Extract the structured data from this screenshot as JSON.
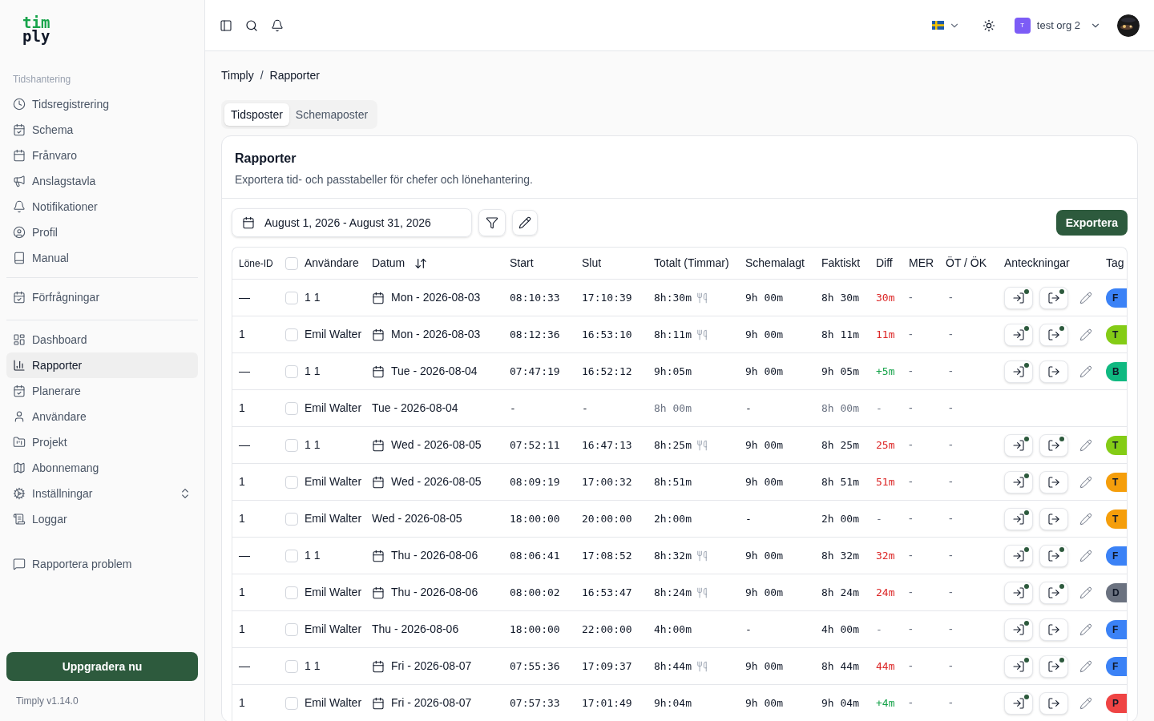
{
  "logo": {
    "top": "tim",
    "bottom": "ply"
  },
  "sidebar": {
    "groups": [
      {
        "label": "Tidshantering",
        "items": [
          {
            "label": "Tidsregistrering",
            "selected": false,
            "expandable": false
          },
          {
            "label": "Schema",
            "selected": false,
            "expandable": false
          },
          {
            "label": "Frånvaro",
            "selected": false,
            "expandable": false
          },
          {
            "label": "Anslagstavla",
            "selected": false,
            "expandable": false
          },
          {
            "label": "Notifikationer",
            "selected": false,
            "expandable": false
          },
          {
            "label": "Profil",
            "selected": false,
            "expandable": false
          },
          {
            "label": "Manual",
            "selected": false,
            "expandable": false
          }
        ]
      },
      {
        "items": [
          {
            "label": "Förfrågningar",
            "selected": false,
            "expandable": false
          }
        ]
      },
      {
        "items": [
          {
            "label": "Dashboard",
            "selected": false,
            "expandable": false
          },
          {
            "label": "Rapporter",
            "selected": true,
            "expandable": false
          },
          {
            "label": "Planerare",
            "selected": false,
            "expandable": false
          },
          {
            "label": "Användare",
            "selected": false,
            "expandable": false
          },
          {
            "label": "Projekt",
            "selected": false,
            "expandable": false
          },
          {
            "label": "Abonnemang",
            "selected": false,
            "expandable": false
          },
          {
            "label": "Inställningar",
            "selected": false,
            "expandable": true
          },
          {
            "label": "Loggar",
            "selected": false,
            "expandable": false
          }
        ]
      },
      {
        "items": [
          {
            "label": "Rapportera problem",
            "selected": false,
            "expandable": false
          }
        ]
      }
    ],
    "upgrade_button": "Uppgradera nu",
    "version": "Timply v1.14.0"
  },
  "header": {
    "org_badge": "T",
    "org_name": "test org 2"
  },
  "breadcrumb": {
    "items": [
      "Timply",
      "Rapporter"
    ],
    "separator": "/"
  },
  "tabs": [
    {
      "label": "Tidsposter",
      "selected": true
    },
    {
      "label": "Schemaposter",
      "selected": false
    }
  ],
  "card": {
    "title": "Rapporter",
    "subtitle": "Exportera tid- och passtabeller för chefer och lönehantering.",
    "date_range": "August 1, 2026 - August 31, 2026",
    "export_button": "Exportera"
  },
  "table": {
    "columns": [
      "Löne-ID",
      "Användare",
      "Datum",
      "Start",
      "Slut",
      "Totalt (Timmar)",
      "Schemalagt",
      "Faktiskt",
      "Diff",
      "MER",
      "ÖT / ÖK",
      "Anteckningar",
      "Tag"
    ],
    "select_all": {
      "checked": false
    },
    "rows": [
      {
        "id": "—",
        "checked": false,
        "user": "1 1",
        "date_icon": true,
        "date": "Mon - 2026-08-03",
        "start": "08:10:33",
        "end": "17:10:39",
        "total": "8h:30m",
        "meal": true,
        "scheduled": "9h 00m",
        "actual": "8h 30m",
        "muted": false,
        "diff": {
          "text": "30m",
          "color": "#dc2626"
        },
        "mer": "-",
        "ot": "-",
        "notes": {
          "in_dot": true,
          "out_dot": true
        },
        "tag": {
          "letter": "F",
          "color": "#3b82f6"
        }
      },
      {
        "id": "1",
        "checked": false,
        "user": "Emil Walter",
        "date_icon": true,
        "date": "Mon - 2026-08-03",
        "start": "08:12:36",
        "end": "16:53:10",
        "total": "8h:11m",
        "meal": true,
        "scheduled": "9h 00m",
        "actual": "8h 11m",
        "muted": false,
        "diff": {
          "text": "11m",
          "color": "#dc2626"
        },
        "mer": "-",
        "ot": "-",
        "notes": {
          "in_dot": true,
          "out_dot": true
        },
        "tag": {
          "letter": "T",
          "color": "#84cc16"
        }
      },
      {
        "id": "—",
        "checked": false,
        "user": "1 1",
        "date_icon": true,
        "date": "Tue - 2026-08-04",
        "start": "07:47:19",
        "end": "16:52:12",
        "total": "9h:05m",
        "meal": false,
        "scheduled": "9h 00m",
        "actual": "9h 05m",
        "muted": false,
        "diff": {
          "text": "+5m",
          "color": "#16a34a"
        },
        "mer": "-",
        "ot": "-",
        "notes": {
          "in_dot": true,
          "out_dot": false
        },
        "tag": {
          "letter": "B",
          "color": "#10b981"
        }
      },
      {
        "id": "1",
        "checked": false,
        "user": "Emil Walter",
        "date_icon": false,
        "date": "Tue - 2026-08-04",
        "start": "-",
        "end": "-",
        "total": "8h 00m",
        "meal": false,
        "scheduled": "-",
        "actual": "8h 00m",
        "muted": true,
        "diff": {
          "text": "-"
        },
        "mer": "-",
        "ot": "-"
      },
      {
        "id": "—",
        "checked": false,
        "user": "1 1",
        "date_icon": true,
        "date": "Wed - 2026-08-05",
        "start": "07:52:11",
        "end": "16:47:13",
        "total": "8h:25m",
        "meal": true,
        "scheduled": "9h 00m",
        "actual": "8h 25m",
        "muted": false,
        "diff": {
          "text": "25m",
          "color": "#dc2626"
        },
        "mer": "-",
        "ot": "-",
        "notes": {
          "in_dot": true,
          "out_dot": true
        },
        "tag": {
          "letter": "T",
          "color": "#84cc16"
        }
      },
      {
        "id": "1",
        "checked": false,
        "user": "Emil Walter",
        "date_icon": true,
        "date": "Wed - 2026-08-05",
        "start": "08:09:19",
        "end": "17:00:32",
        "total": "8h:51m",
        "meal": false,
        "scheduled": "9h 00m",
        "actual": "8h 51m",
        "muted": false,
        "diff": {
          "text": "51m",
          "color": "#dc2626"
        },
        "mer": "-",
        "ot": "-",
        "notes": {
          "in_dot": true,
          "out_dot": false
        },
        "tag": {
          "letter": "T",
          "color": "#f59e0b"
        }
      },
      {
        "id": "1",
        "checked": false,
        "user": "Emil Walter",
        "date_icon": false,
        "date": "Wed - 2026-08-05",
        "start": "18:00:00",
        "end": "20:00:00",
        "total": "2h:00m",
        "meal": false,
        "scheduled": "-",
        "actual": "2h 00m",
        "muted": false,
        "diff": {
          "text": "-"
        },
        "mer": "-",
        "ot": "-",
        "notes": {
          "in_dot": true,
          "out_dot": false
        },
        "tag": {
          "letter": "T",
          "color": "#f59e0b"
        }
      },
      {
        "id": "—",
        "checked": false,
        "user": "1 1",
        "date_icon": true,
        "date": "Thu - 2026-08-06",
        "start": "08:06:41",
        "end": "17:08:52",
        "total": "8h:32m",
        "meal": true,
        "scheduled": "9h 00m",
        "actual": "8h 32m",
        "muted": false,
        "diff": {
          "text": "32m",
          "color": "#dc2626"
        },
        "mer": "-",
        "ot": "-",
        "notes": {
          "in_dot": true,
          "out_dot": true
        },
        "tag": {
          "letter": "F",
          "color": "#3b82f6"
        }
      },
      {
        "id": "1",
        "checked": false,
        "user": "Emil Walter",
        "date_icon": true,
        "date": "Thu - 2026-08-06",
        "start": "08:00:02",
        "end": "16:53:47",
        "total": "8h:24m",
        "meal": true,
        "scheduled": "9h 00m",
        "actual": "8h 24m",
        "muted": false,
        "diff": {
          "text": "24m",
          "color": "#dc2626"
        },
        "mer": "-",
        "ot": "-",
        "notes": {
          "in_dot": true,
          "out_dot": true
        },
        "tag": {
          "letter": "D",
          "color": "#6b7280"
        }
      },
      {
        "id": "1",
        "checked": false,
        "user": "Emil Walter",
        "date_icon": false,
        "date": "Thu - 2026-08-06",
        "start": "18:00:00",
        "end": "22:00:00",
        "total": "4h:00m",
        "meal": false,
        "scheduled": "-",
        "actual": "4h 00m",
        "muted": false,
        "diff": {
          "text": "-"
        },
        "mer": "-",
        "ot": "-",
        "notes": {
          "in_dot": true,
          "out_dot": false
        },
        "tag": {
          "letter": "F",
          "color": "#3b82f6"
        }
      },
      {
        "id": "—",
        "checked": false,
        "user": "1 1",
        "date_icon": true,
        "date": "Fri - 2026-08-07",
        "start": "07:55:36",
        "end": "17:09:37",
        "total": "8h:44m",
        "meal": true,
        "scheduled": "9h 00m",
        "actual": "8h 44m",
        "muted": false,
        "diff": {
          "text": "44m",
          "color": "#dc2626"
        },
        "mer": "-",
        "ot": "-",
        "notes": {
          "in_dot": true,
          "out_dot": true
        },
        "tag": {
          "letter": "F",
          "color": "#3b82f6"
        }
      },
      {
        "id": "1",
        "checked": false,
        "user": "Emil Walter",
        "date_icon": true,
        "date": "Fri - 2026-08-07",
        "start": "07:57:33",
        "end": "17:01:49",
        "total": "9h:04m",
        "meal": false,
        "scheduled": "9h 00m",
        "actual": "9h 04m",
        "muted": false,
        "diff": {
          "text": "+4m",
          "color": "#16a34a"
        },
        "mer": "-",
        "ot": "-",
        "notes": {
          "in_dot": true,
          "out_dot": false
        },
        "tag": {
          "letter": "P",
          "color": "#ef4444"
        }
      }
    ]
  }
}
